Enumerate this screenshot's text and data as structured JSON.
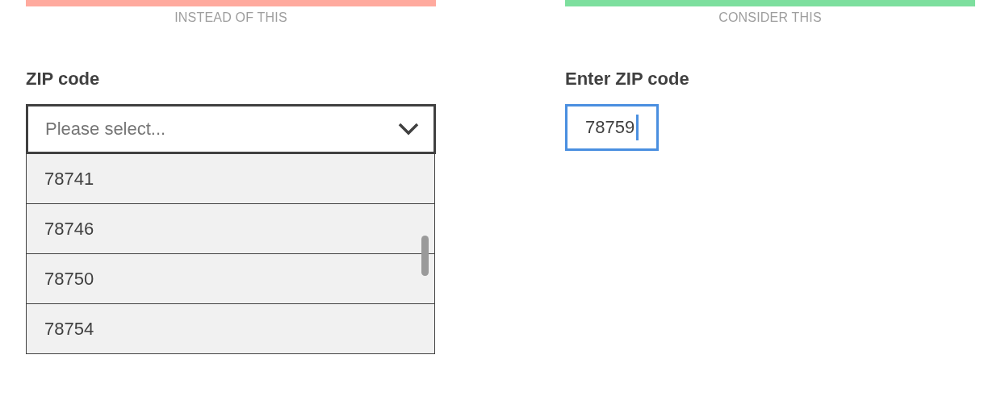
{
  "columns": [
    {
      "caption": "INSTEAD OF THIS",
      "color": "#ffaa9e",
      "kind": "select",
      "label": "ZIP code",
      "placeholder": "Please select...",
      "expanded": true,
      "options": [
        "78741",
        "78746",
        "78750",
        "78754"
      ]
    },
    {
      "caption": "CONSIDER THIS",
      "color": "#7ddf9e",
      "kind": "text",
      "label": "Enter ZIP code",
      "value": "78759",
      "focused": true
    }
  ]
}
